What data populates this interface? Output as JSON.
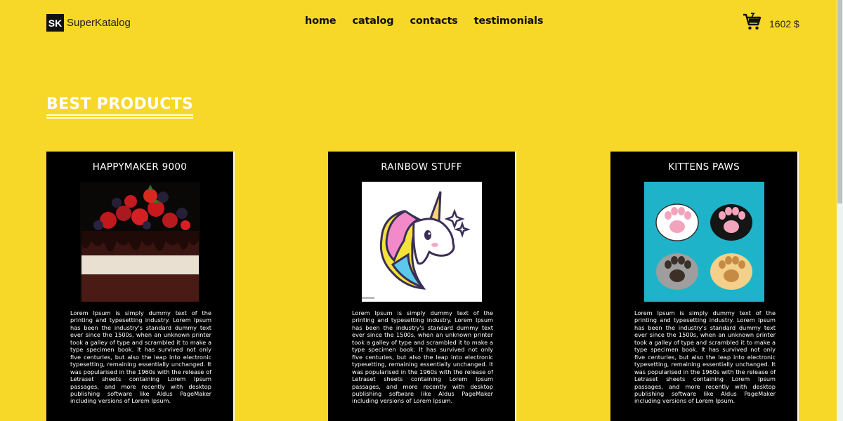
{
  "header": {
    "logo_mark": "SK",
    "brand": "SuperKatalog",
    "nav": [
      {
        "label": "home"
      },
      {
        "label": "catalog"
      },
      {
        "label": "contacts"
      },
      {
        "label": "testimonials"
      }
    ],
    "cart_total": "1602 $",
    "cart_icon": "shopping-cart-icon"
  },
  "section": {
    "title": "BEST PRODUCTS"
  },
  "products": [
    {
      "title": "HAPPYMAKER 9000",
      "image": "berry-chocolate-cake",
      "description": "Lorem Ipsum is simply dummy text of the printing and typesetting industry. Lorem Ipsum has been the industry's standard dummy text ever since the 1500s, when an unknown printer took a galley of type and scrambled it to make a type specimen book. It has survived not only five centuries, but also the leap into electronic typesetting, remaining essentially unchanged. It was popularised in the 1960s with the release of Letraset sheets containing Lorem Ipsum passages, and more recently with desktop publishing software like Aldus PageMaker including versions of Lorem Ipsum."
    },
    {
      "title": "RAINBOW STUFF",
      "image": "unicorn-head",
      "description": "Lorem Ipsum is simply dummy text of the printing and typesetting industry. Lorem Ipsum has been the industry's standard dummy text ever since the 1500s, when an unknown printer took a galley of type and scrambled it to make a type specimen book. It has survived not only five centuries, but also the leap into electronic typesetting, remaining essentially unchanged. It was popularised in the 1960s with the release of Letraset sheets containing Lorem Ipsum passages, and more recently with desktop publishing software like Aldus PageMaker including versions of Lorem Ipsum."
    },
    {
      "title": "KITTENS PAWS",
      "image": "cat-paws",
      "description": "Lorem Ipsum is simply dummy text of the printing and typesetting industry. Lorem Ipsum has been the industry's standard dummy text ever since the 1500s, when an unknown printer took a galley of type and scrambled it to make a type specimen book. It has survived not only five centuries, but also the leap into electronic typesetting, remaining essentially unchanged. It was popularised in the 1960s with the release of Letraset sheets containing Lorem Ipsum passages, and more recently with desktop publishing software like Aldus PageMaker including versions of Lorem Ipsum."
    }
  ],
  "colors": {
    "background": "#f7d728",
    "card": "#000000",
    "title_text": "#ffffff",
    "paws_bg": "#1fb3c9"
  }
}
